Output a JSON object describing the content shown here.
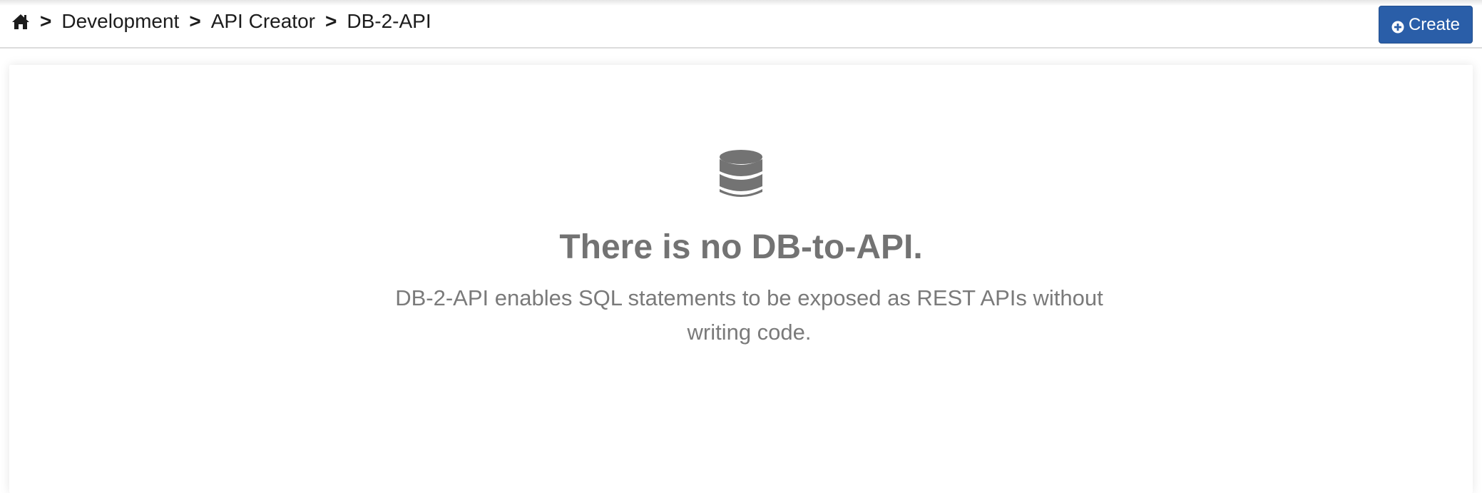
{
  "breadcrumb": {
    "home_icon": "home-icon",
    "separator": ">",
    "items": [
      "Development",
      "API Creator",
      "DB-2-API"
    ]
  },
  "toolbar": {
    "create_label": "Create",
    "create_icon": "plus-circle-icon",
    "create_color": "#2a5ea8"
  },
  "empty_state": {
    "icon": "database-icon",
    "title": "There is no DB-to-API.",
    "description": "DB-2-API enables SQL statements to be exposed as REST APIs without writing code."
  }
}
